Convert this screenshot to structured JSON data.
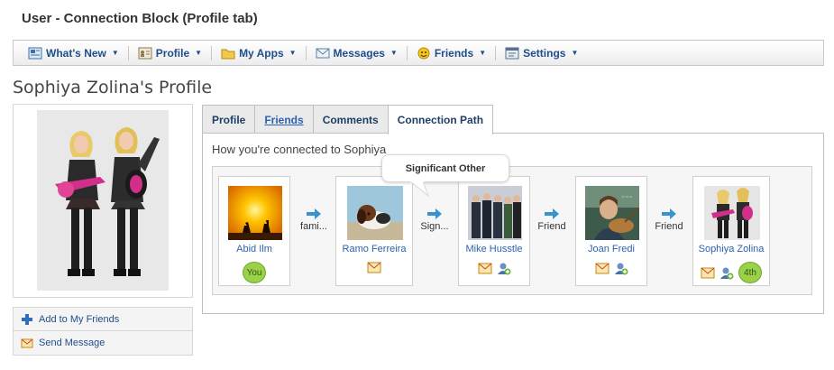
{
  "page": {
    "title": "User - Connection Block (Profile tab)"
  },
  "nav": {
    "items": [
      {
        "label": "What's New",
        "icon": "newspaper-icon"
      },
      {
        "label": "Profile",
        "icon": "profile-card-icon"
      },
      {
        "label": "My Apps",
        "icon": "folder-icon"
      },
      {
        "label": "Messages",
        "icon": "envelope-icon"
      },
      {
        "label": "Friends",
        "icon": "smiley-icon"
      },
      {
        "label": "Settings",
        "icon": "settings-window-icon"
      }
    ]
  },
  "profile": {
    "heading": "Sophiya Zolina's Profile"
  },
  "sidebar": {
    "actions": [
      {
        "label": "Add to My Friends",
        "icon": "plus-icon"
      },
      {
        "label": "Send Message",
        "icon": "envelope-icon"
      }
    ]
  },
  "tabs": [
    {
      "label": "Profile"
    },
    {
      "label": "Friends"
    },
    {
      "label": "Comments"
    },
    {
      "label": "Connection Path"
    }
  ],
  "connection": {
    "heading": "How you're connected to Sophiya",
    "tooltip": "Significant Other",
    "people": [
      {
        "name": "Abid Ilm",
        "badge": "You"
      },
      {
        "name": "Ramo Ferreira"
      },
      {
        "name": "Mike Husstle"
      },
      {
        "name": "Joan Fredi"
      },
      {
        "name": "Sophiya Zolina",
        "badge": "4th"
      }
    ],
    "links": [
      {
        "label": "fami..."
      },
      {
        "label": "Sign..."
      },
      {
        "label": "Friend"
      },
      {
        "label": "Friend"
      }
    ]
  },
  "colors": {
    "link": "#2a62b0",
    "nav_text": "#1f4e8c",
    "badge_green": "#9bd14a",
    "arrow_blue": "#3a93d1"
  }
}
